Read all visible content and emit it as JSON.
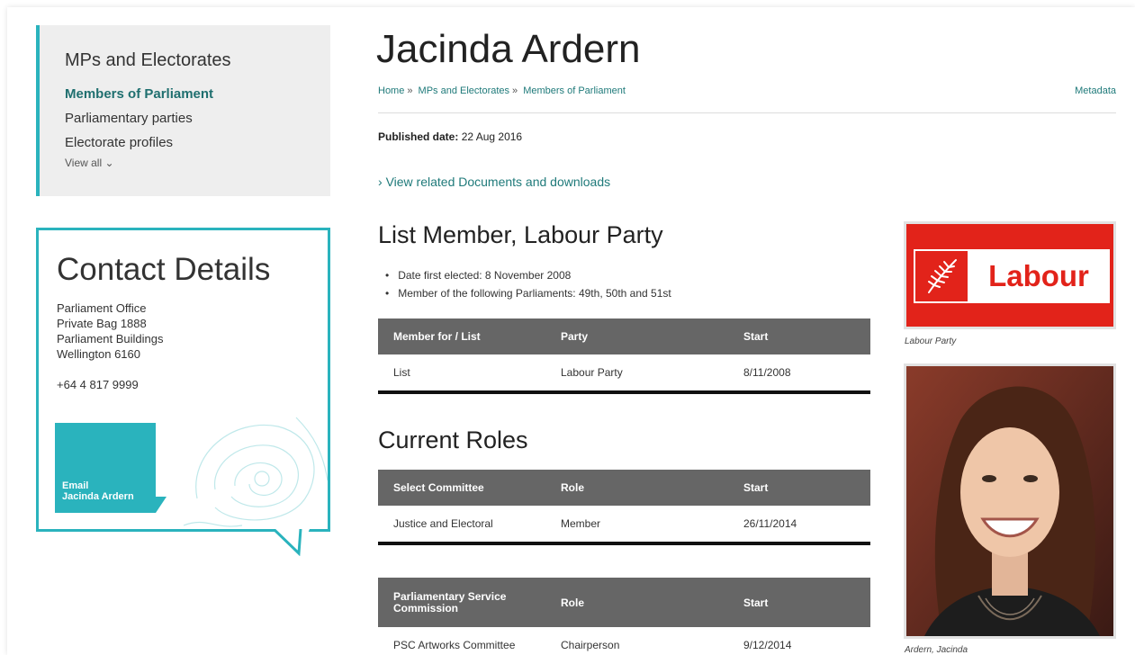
{
  "sidebar": {
    "title": "MPs and Electorates",
    "items": [
      {
        "label": "Members of Parliament",
        "active": true
      },
      {
        "label": "Parliamentary parties",
        "active": false
      },
      {
        "label": "Electorate profiles",
        "active": false
      }
    ],
    "view_all": "View all"
  },
  "contact": {
    "title": "Contact Details",
    "address": [
      "Parliament Office",
      "Private Bag 1888",
      "Parliament Buildings",
      "Wellington 6160"
    ],
    "phone": "+64 4 817 9999",
    "email_line1": "Email",
    "email_line2": "Jacinda Ardern"
  },
  "page": {
    "title": "Jacinda Ardern",
    "breadcrumb": [
      "Home",
      "MPs and Electorates",
      "Members of Parliament"
    ],
    "metadata": "Metadata",
    "published_label": "Published date:",
    "published_value": "22 Aug 2016",
    "related": "View related Documents and downloads"
  },
  "member": {
    "heading": "List Member, Labour Party",
    "facts": [
      "Date first elected: 8 November 2008",
      "Member of the following Parliaments: 49th, 50th and 51st"
    ],
    "table": {
      "headers": [
        "Member for / List",
        "Party",
        "Start"
      ],
      "rows": [
        [
          "List",
          "Labour Party",
          "8/11/2008"
        ]
      ]
    }
  },
  "roles": {
    "heading": "Current Roles",
    "select_committee": {
      "headers": [
        "Select Committee",
        "Role",
        "Start"
      ],
      "rows": [
        [
          "Justice and Electoral",
          "Member",
          "26/11/2014"
        ]
      ]
    },
    "psc": {
      "headers": [
        "Parliamentary Service Commission",
        "Role",
        "Start"
      ],
      "rows": [
        [
          "PSC Artworks Committee",
          "Chairperson",
          "9/12/2014"
        ]
      ]
    }
  },
  "images": {
    "party_logo_text": "Labour",
    "party_caption": "Labour Party",
    "photo_caption": "Ardern, Jacinda"
  },
  "colors": {
    "accent": "#2ab3bd",
    "link": "#1f7a7a",
    "table_header": "#666666",
    "labour_red": "#e2231a"
  }
}
